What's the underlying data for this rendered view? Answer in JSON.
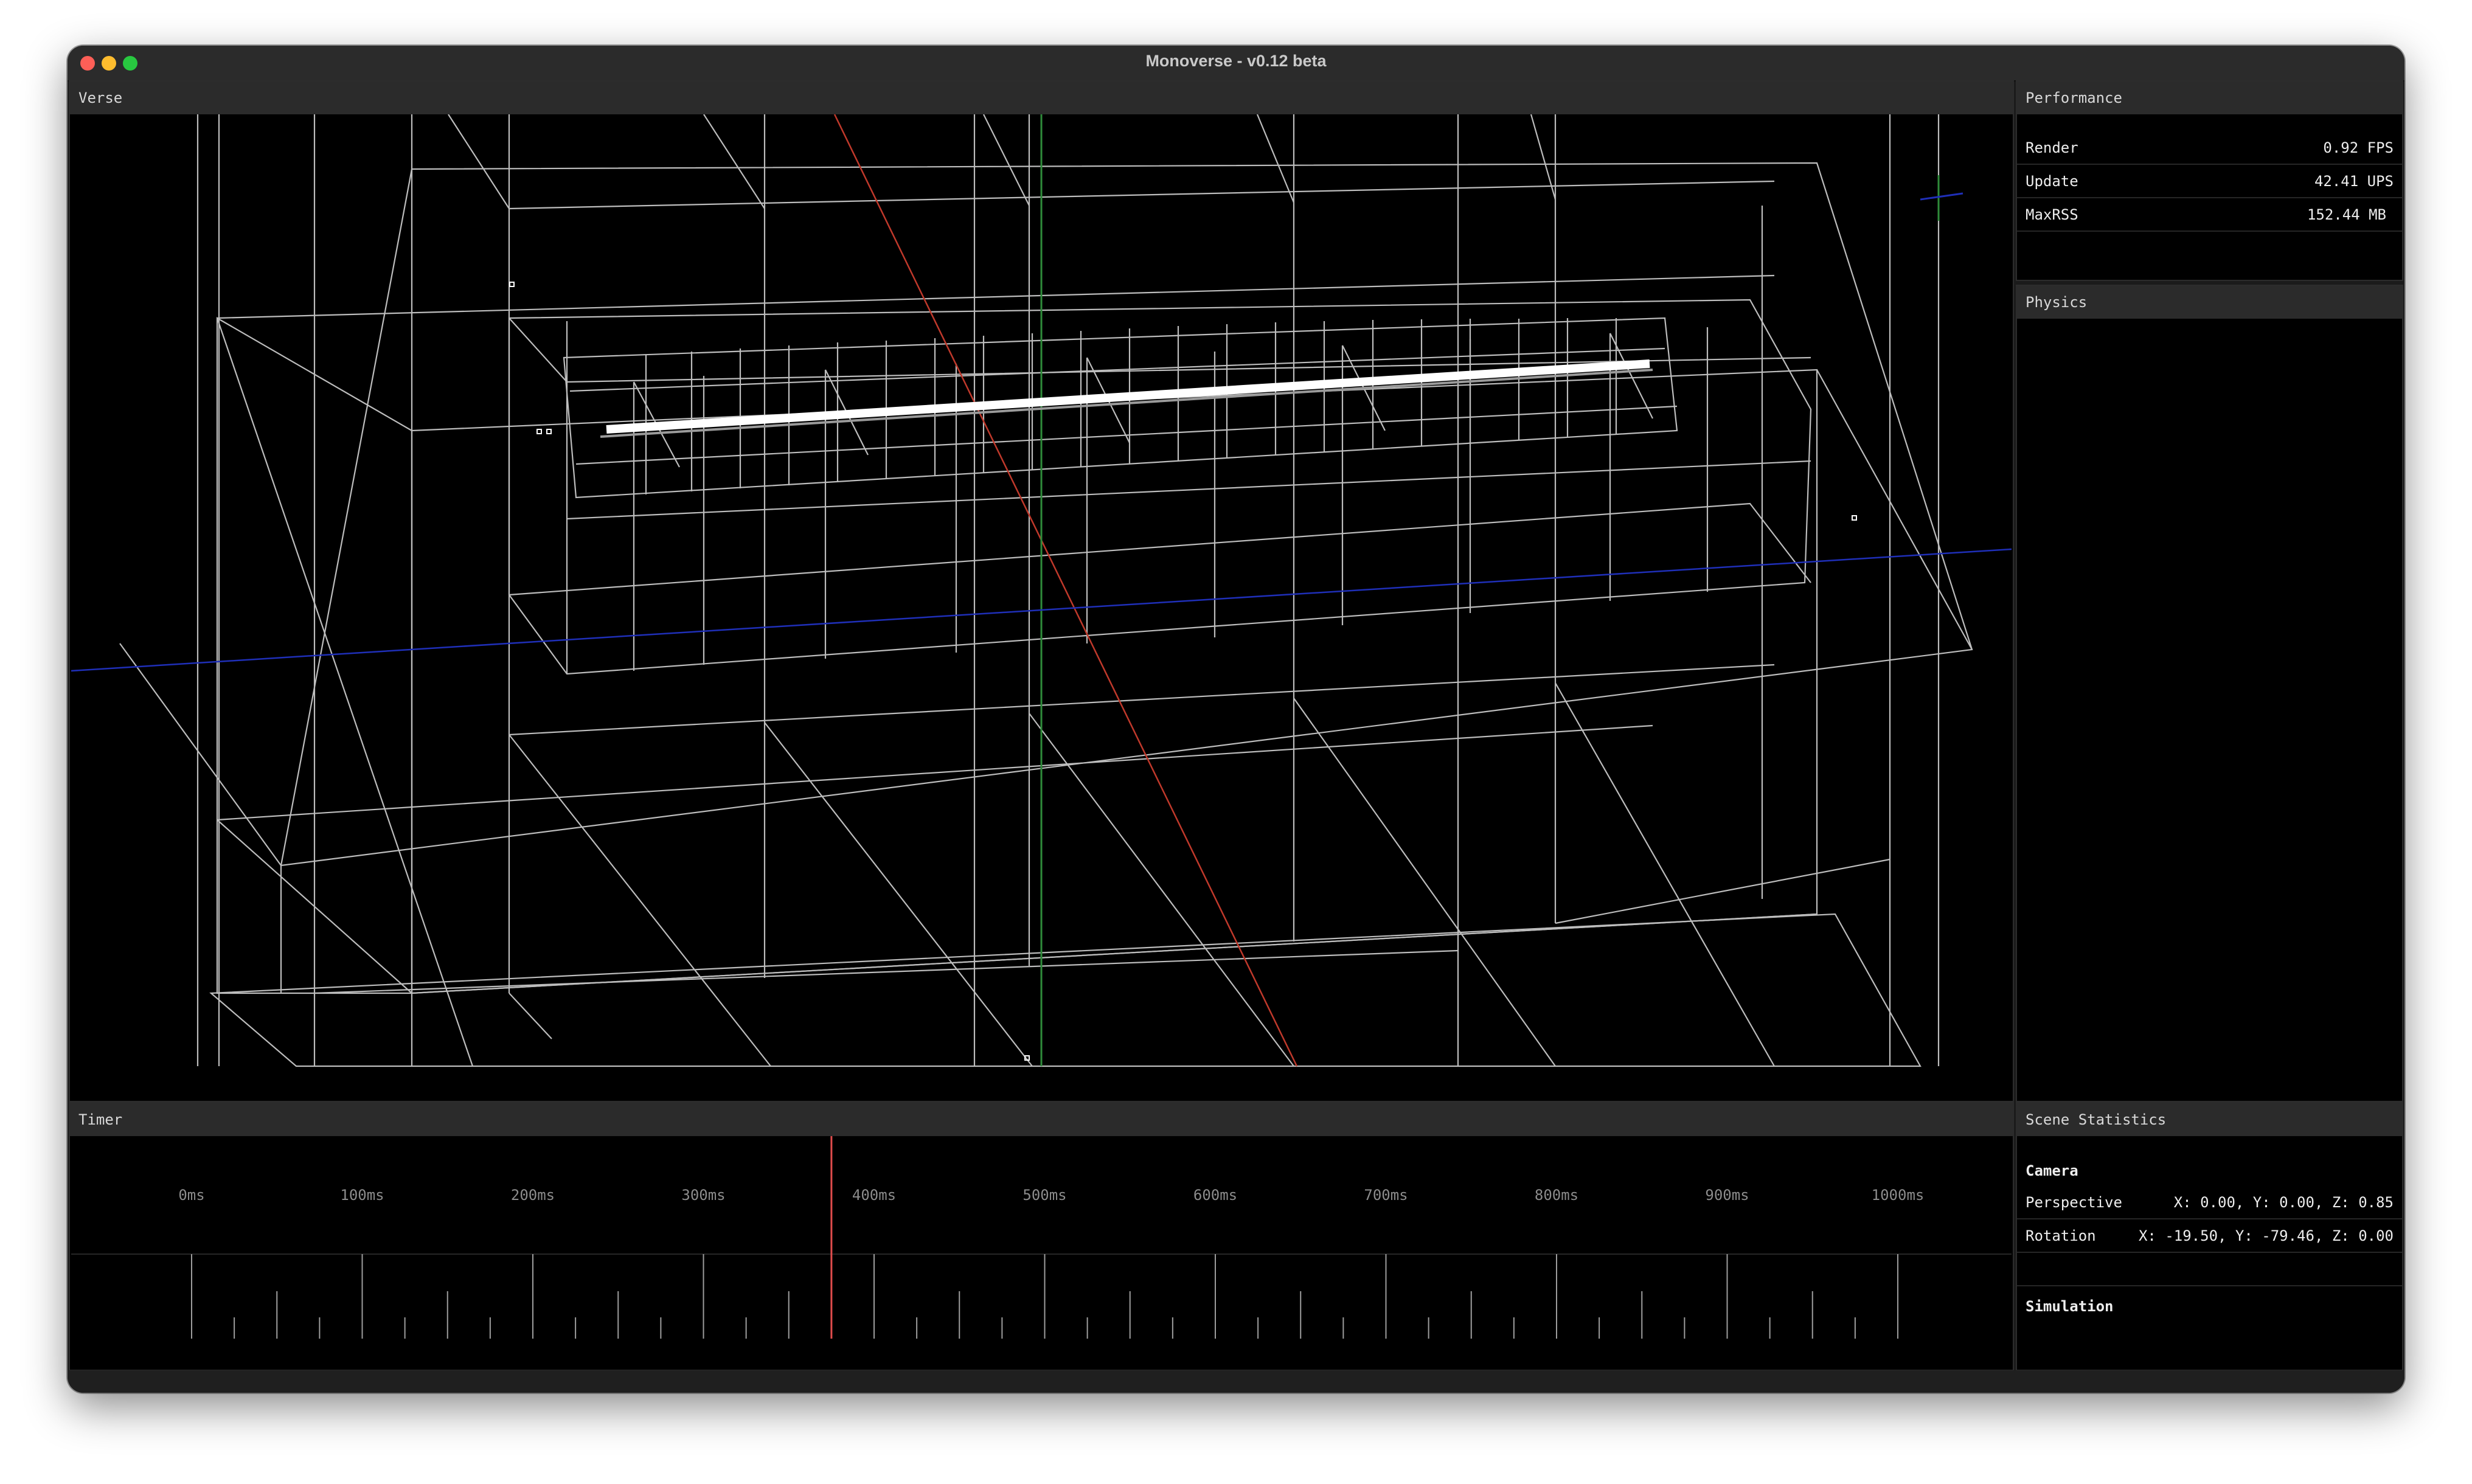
{
  "window": {
    "title": "Monoverse - v0.12 beta"
  },
  "verse": {
    "header": "Verse"
  },
  "performance": {
    "header": "Performance",
    "rows": [
      {
        "label": "Render",
        "value": "0.92 FPS"
      },
      {
        "label": "Update",
        "value": "42.41 UPS"
      },
      {
        "label": "MaxRSS",
        "value": "152.44 MB"
      }
    ]
  },
  "physics": {
    "header": "Physics"
  },
  "timer": {
    "header": "Timer",
    "ticks": [
      "0ms",
      "100ms",
      "200ms",
      "300ms",
      "400ms",
      "500ms",
      "600ms",
      "700ms",
      "800ms",
      "900ms",
      "1000ms"
    ],
    "cursor_ms": 375
  },
  "scene_statistics": {
    "header": "Scene Statistics",
    "camera_title": "Camera",
    "rows": [
      {
        "label": "Perspective",
        "value": "X: 0.00, Y: 0.00, Z: 0.85"
      },
      {
        "label": "Rotation",
        "value": "X: -19.50, Y: -79.46, Z: 0.00"
      }
    ],
    "simulation_title": "Simulation"
  },
  "colors": {
    "x_axis": "#c0392b",
    "y_axis": "#2e8b3a",
    "z_axis": "#1f2fb8",
    "timer_cursor": "#e04c4c",
    "grid_line": "#bdbdbd"
  }
}
